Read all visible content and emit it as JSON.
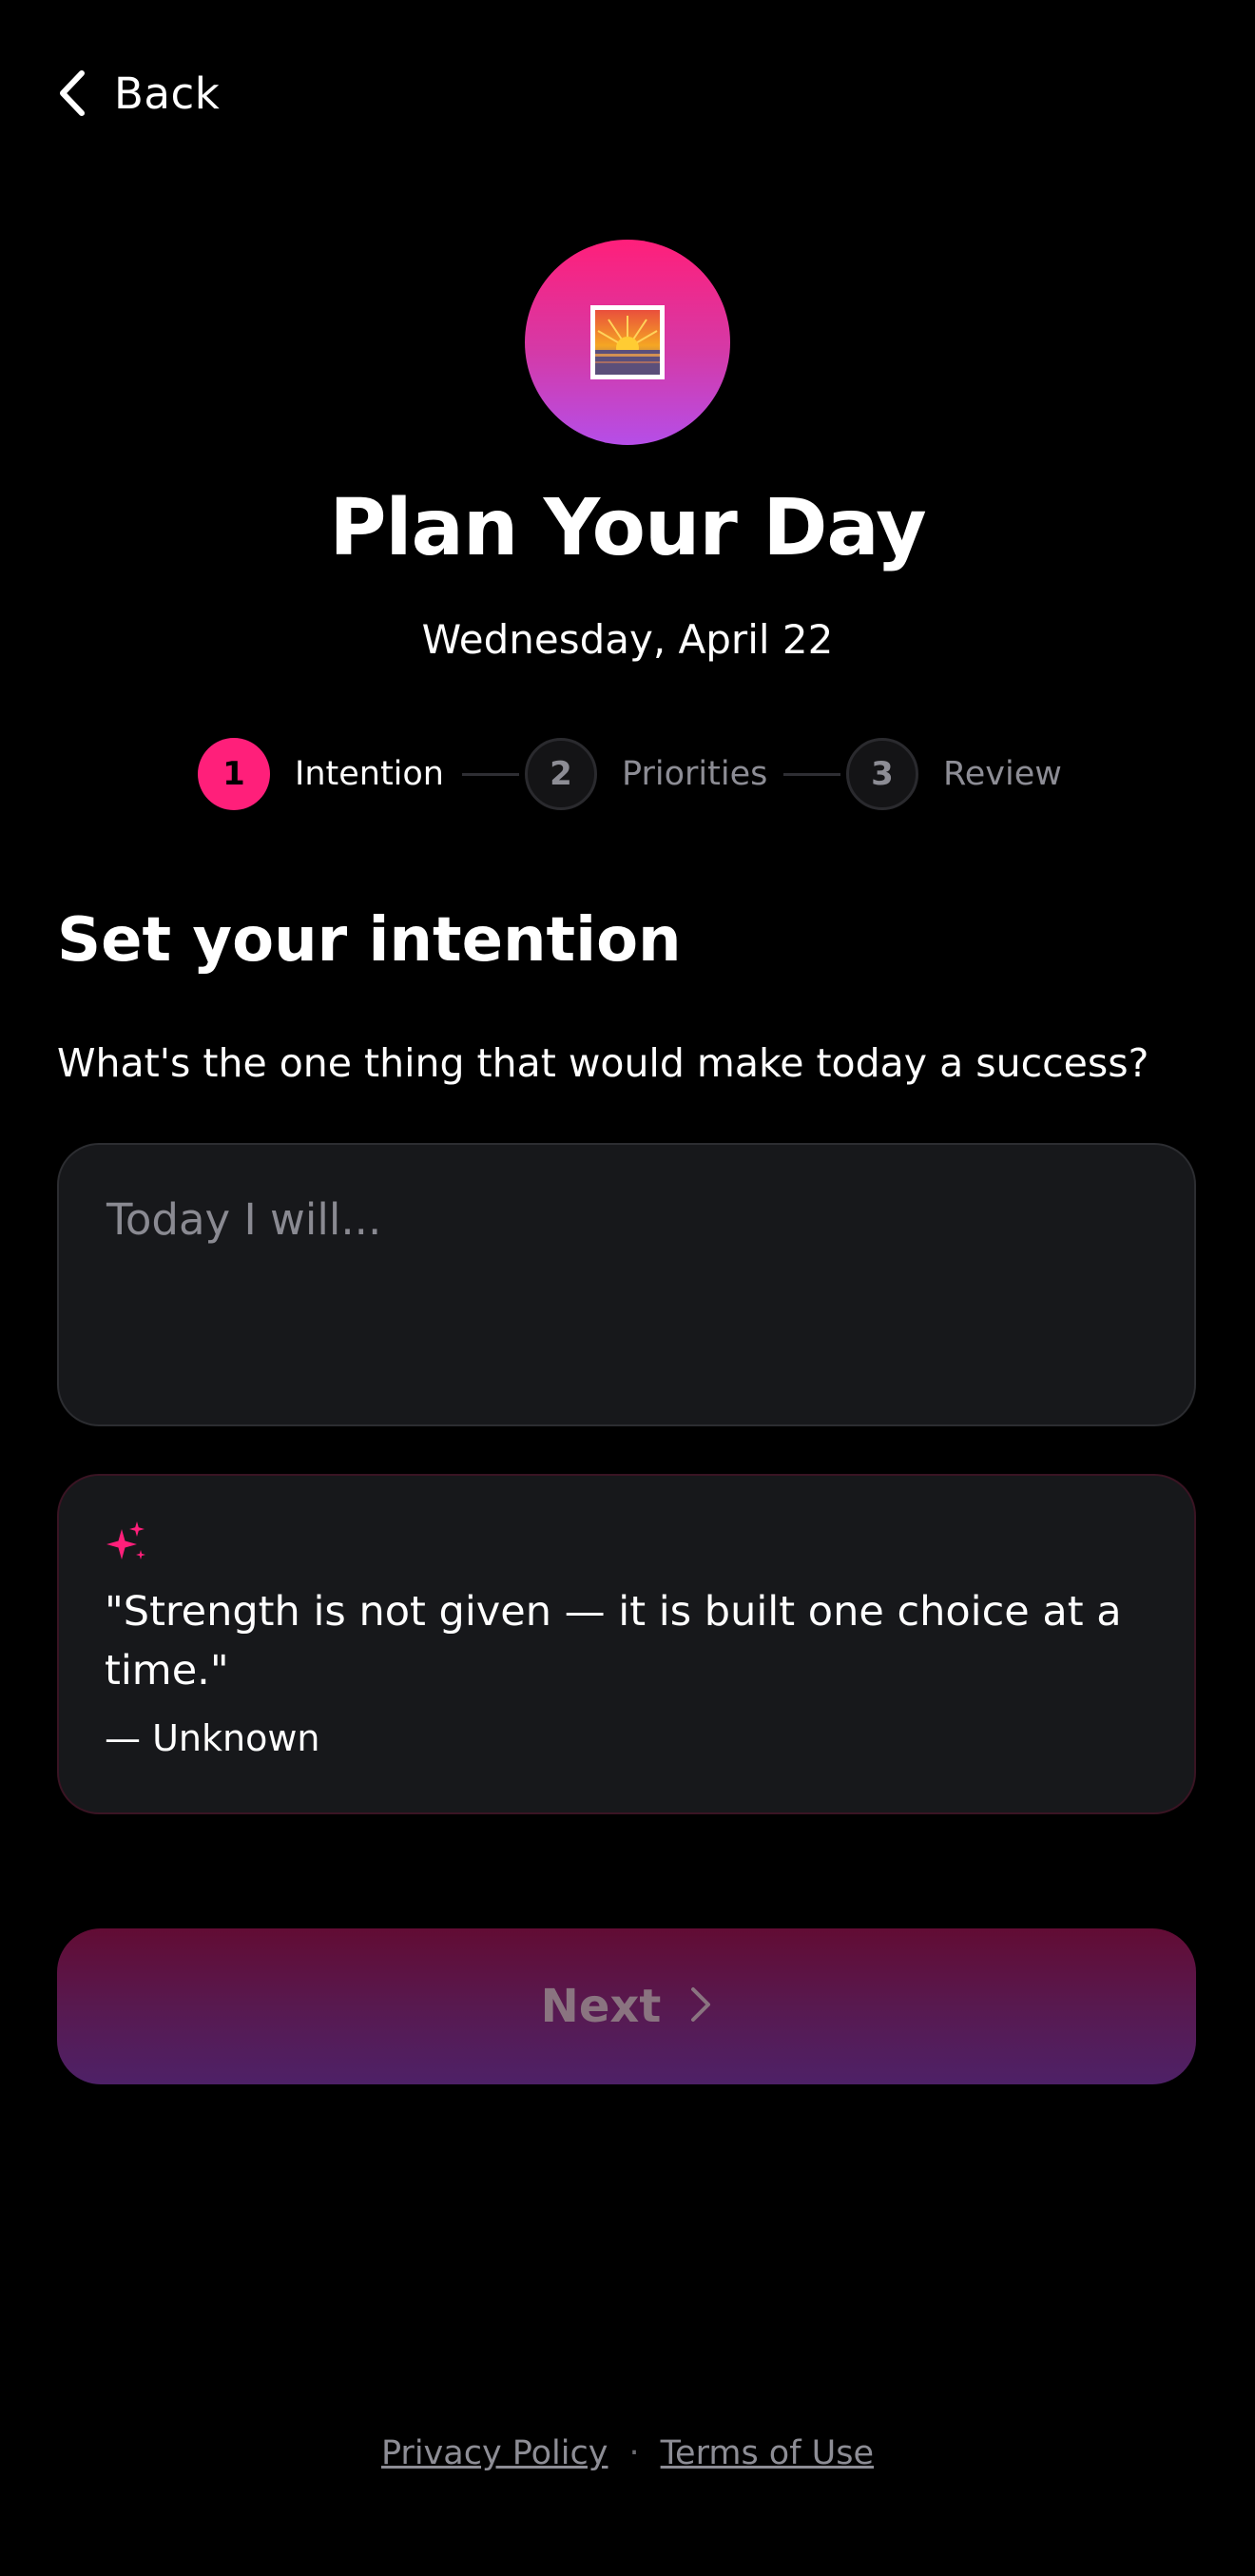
{
  "header": {
    "back_label": "Back",
    "back_icon": "chevron-left-icon"
  },
  "hero": {
    "icon": "sunrise-icon",
    "gradient_top": "#ff1f7a",
    "gradient_bottom": "#b54ee8"
  },
  "title": "Plan Your Day",
  "date": "Wednesday, April 22",
  "steps": [
    {
      "number": "1",
      "label": "Intention",
      "state": "active"
    },
    {
      "number": "2",
      "label": "Priorities",
      "state": "inactive"
    },
    {
      "number": "3",
      "label": "Review",
      "state": "inactive"
    }
  ],
  "section": {
    "heading": "Set your intention",
    "question": "What's the one thing that would make today a success?"
  },
  "intention_input": {
    "placeholder": "Today I will...",
    "value": ""
  },
  "quote": {
    "icon": "sparkles-icon",
    "text": "\"Strength is not given — it is built one choice at a time.\"",
    "author": "— Unknown"
  },
  "next_button": {
    "label": "Next",
    "icon": "chevron-right-icon",
    "disabled": true
  },
  "footer": {
    "privacy": "Privacy Policy",
    "separator": "·",
    "terms": "Terms of Use"
  },
  "colors": {
    "accent": "#ff1f7a",
    "background": "#000000",
    "card": "#17181b"
  }
}
